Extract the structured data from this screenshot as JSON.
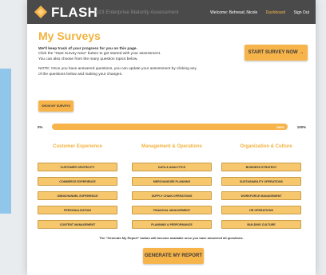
{
  "header": {
    "brand": "FLASH",
    "subtitle": "2023 Enterprise Maturity Assessment",
    "nav": {
      "welcome": "Welcome: Behread, Nicole",
      "dashboard": "Dashboard",
      "sign_out": "Sign Out"
    }
  },
  "main": {
    "title": "My Surveys",
    "intro": {
      "lead": "We'll keep track of your progress for you on this page.",
      "line1": "Click the \"Start Survey Now\" button to get started with your assessment.",
      "line2": "You can also choose from the many question topics below.",
      "note": "NOTE: Once you have answered questions, you can update your assessment by clicking any of the questions below and making your changes."
    },
    "start_button": "START SURVEY NOW →",
    "show_button": "SHOW MY SURVEYS",
    "progress": {
      "left_label": "0%",
      "right_label": "100%",
      "fill_label": "100%",
      "value": 1.0
    },
    "columns": [
      {
        "title": "Customer Experience",
        "topics": [
          "CUSTOMER CENTRICITY",
          "COMMERCE EXPERIENCE",
          "OMNICHANNEL EXPERIENCE",
          "PERSONALIZATION",
          "CONTENT MANAGEMENT"
        ]
      },
      {
        "title": "Management & Operations",
        "topics": [
          "DATA & ANALYTICS",
          "MERCHANDISE PLANNING",
          "SUPPLY CHAIN OPERATIONS",
          "FINANCIAL MANAGEMENT",
          "PLANNING & PERFORMANCE"
        ]
      },
      {
        "title": "Organization & Culture",
        "topics": [
          "BUSINESS STRATEGY",
          "SUSTAINABILITY OPERATIONS",
          "WORKFORCE MANAGEMENT",
          "HR OPERATIONS",
          "BUILDING CULTURE"
        ]
      }
    ],
    "footnote": "The \"Generate My Report\" button will become available once you have answered all questions.",
    "generate_button": "GENERATE MY REPORT"
  },
  "colors": {
    "accent": "#f7b44a",
    "title": "#f2b23d",
    "topbar": "#4a4a4a",
    "side_accent": "#8fc6ea"
  },
  "icons": {
    "logo": "diamond-logo-icon"
  }
}
